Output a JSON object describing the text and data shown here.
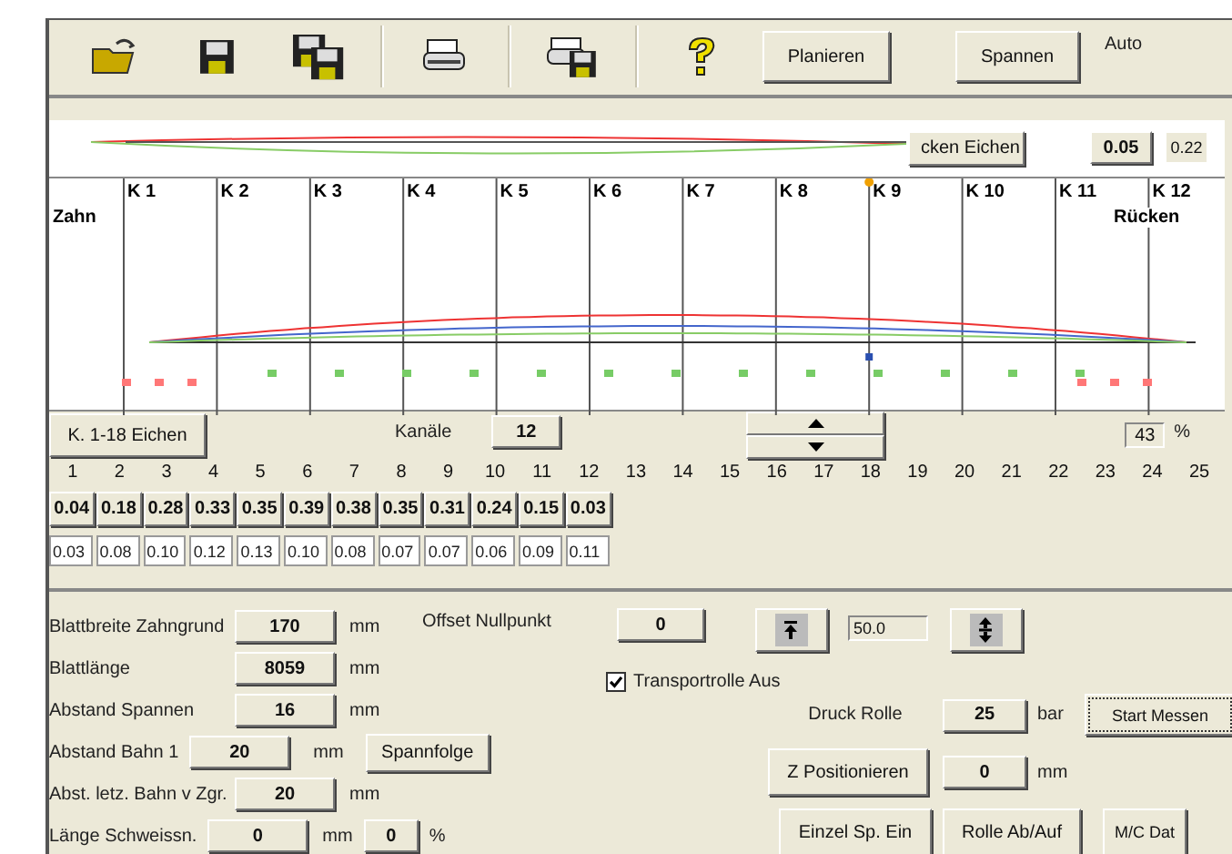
{
  "toolbar": {
    "buttons": [
      {
        "label": "Planieren"
      },
      {
        "label": "Spannen"
      }
    ],
    "mode_label": "Auto"
  },
  "overview": {
    "calibrate_button": "cken Eichen",
    "value": "0.05",
    "reading": "0.22"
  },
  "chart": {
    "left_label": "Zahn",
    "right_label": "Rücken",
    "channels": [
      {
        "label": "K 1",
        "selected": false
      },
      {
        "label": "K 2",
        "selected": false
      },
      {
        "label": "K 3",
        "selected": false
      },
      {
        "label": "K 4",
        "selected": false
      },
      {
        "label": "K 5",
        "selected": false
      },
      {
        "label": "K 6",
        "selected": false
      },
      {
        "label": "K 7",
        "selected": false
      },
      {
        "label": "K 8",
        "selected": false
      },
      {
        "label": "K 9",
        "selected": true
      },
      {
        "label": "K 10",
        "selected": false
      },
      {
        "label": "K 11",
        "selected": false
      },
      {
        "label": "K 12",
        "selected": false
      }
    ]
  },
  "channel_controls": {
    "calibrate_button": "K. 1-18 Eichen",
    "channels_label": "Kanäle",
    "channels_value": "12",
    "percent_value": "43",
    "percent_unit": "%"
  },
  "channel_numbers": [
    "1",
    "2",
    "3",
    "4",
    "5",
    "6",
    "7",
    "8",
    "9",
    "10",
    "11",
    "12",
    "13",
    "14",
    "15",
    "16",
    "17",
    "18",
    "19",
    "20",
    "21",
    "22",
    "23",
    "24",
    "25"
  ],
  "measured_values": [
    "0.04",
    "0.18",
    "0.28",
    "0.33",
    "0.35",
    "0.39",
    "0.38",
    "0.35",
    "0.31",
    "0.24",
    "0.15",
    "0.03"
  ],
  "set_values": [
    "0.03",
    "0.08",
    "0.10",
    "0.12",
    "0.13",
    "0.10",
    "0.08",
    "0.07",
    "0.07",
    "0.06",
    "0.09",
    "0.11"
  ],
  "settings": [
    {
      "label": "Blattbreite Zahngrund",
      "value": "170",
      "unit": "mm"
    },
    {
      "label": "Blattlänge",
      "value": "8059",
      "unit": "mm"
    },
    {
      "label": "Abstand Spannen",
      "value": "16",
      "unit": "mm"
    },
    {
      "label": "Abstand Bahn 1",
      "value": "20",
      "unit": "mm",
      "button": "Spannfolge"
    },
    {
      "label": "Abst. letz. Bahn v Zgr.",
      "value": "20",
      "unit": "mm"
    },
    {
      "label": "Länge Schweissn.",
      "value": "0",
      "unit": "mm",
      "extra_value": "0",
      "extra_unit": "%"
    }
  ],
  "offset": {
    "label": "Offset Nullpunkt",
    "value": "0",
    "step": "50.0"
  },
  "transport_roller": {
    "label": "Transportrolle Aus",
    "checked": true
  },
  "pressure": {
    "label": "Druck Rolle",
    "value": "25",
    "unit": "bar"
  },
  "start_button": "Start Messen",
  "z_position": {
    "button": "Z Positionieren",
    "value": "0",
    "unit": "mm"
  },
  "bottom_buttons": [
    "Einzel Sp. Ein",
    "Rolle Ab/Auf",
    "M/C Dat"
  ]
}
